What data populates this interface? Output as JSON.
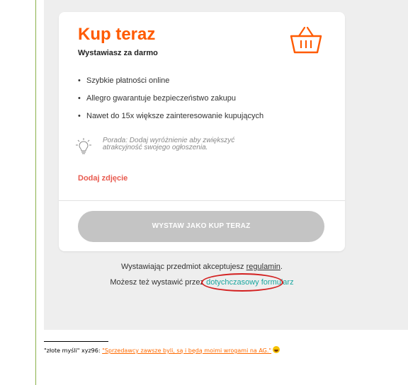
{
  "card": {
    "title": "Kup teraz",
    "subtitle": "Wystawiasz za darmo",
    "basket_icon": "basket-icon",
    "features": [
      "Szybkie płatności online",
      "Allegro gwarantuje bezpieczeństwo zakupu",
      "Nawet do 15x większe zainteresowanie kupujących"
    ],
    "tip_icon": "lightbulb-icon",
    "tip": "Porada: Dodaj wyróżnienie aby zwiększyć atrakcyjność swojego ogłoszenia.",
    "add_photo": "Dodaj zdjęcie",
    "submit_label": "WYSTAW JAKO KUP TERAZ"
  },
  "footer": {
    "terms_prefix": "Wystawiając przedmiot akceptujesz ",
    "terms_link": "regulamin",
    "terms_suffix": ".",
    "alt_prefix": "Możesz też wystawić przez ",
    "alt_link": "dotychczasowy formularz"
  },
  "signature": {
    "prefix": "\"złote myśli\" xyz96: ",
    "quote": "\"Sprzedawcy zawsze byli, są i będą moimi wrogami na AG.\""
  },
  "colors": {
    "brand": "#ff5a00",
    "link": "#1aa7a0",
    "annotation": "#d32020"
  }
}
